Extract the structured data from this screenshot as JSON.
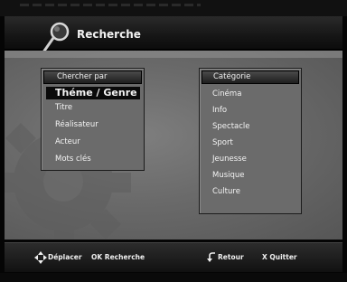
{
  "header": {
    "title": "Recherche",
    "icon": "magnifier-icon"
  },
  "left_panel": {
    "title": "Chercher par",
    "items": [
      {
        "label": "Théme / Genre",
        "selected": true
      },
      {
        "label": "Titre",
        "selected": false
      },
      {
        "label": "Réalisateur",
        "selected": false
      },
      {
        "label": "Acteur",
        "selected": false
      },
      {
        "label": "Mots clés",
        "selected": false
      }
    ]
  },
  "right_panel": {
    "title": "Catégorie",
    "items": [
      {
        "label": "Cinéma"
      },
      {
        "label": "Info"
      },
      {
        "label": "Spectacle"
      },
      {
        "label": "Sport"
      },
      {
        "label": "Jeunesse"
      },
      {
        "label": "Musique"
      },
      {
        "label": "Culture"
      }
    ]
  },
  "footer": {
    "move_label": "Déplacer",
    "ok_label": "OK Recherche",
    "back_label": "Retour",
    "quit_label": "X  Quitter",
    "move_icon": "directional-pad-icon",
    "back_icon": "return-arrow-icon"
  },
  "colors": {
    "background": "#6b6b6b",
    "selected_bg": "#0a0a0a",
    "text": "#f0f0f0"
  }
}
